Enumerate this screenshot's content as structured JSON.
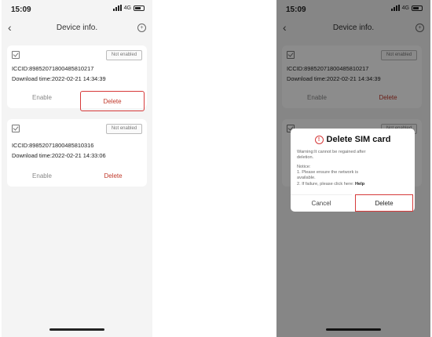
{
  "status": {
    "time": "15:09",
    "network": "4G"
  },
  "nav": {
    "title": "Device info."
  },
  "cards": [
    {
      "badge": "Not enabled",
      "iccid": "ICCID:89852071800485810217",
      "download": "Download time:2022-02-21 14:34:39",
      "enable_label": "Enable",
      "delete_label": "Delete"
    },
    {
      "badge": "Not enabled",
      "iccid": "ICCID:89852071800485810316",
      "download": "Download time:2022-02-21 14:33:06",
      "enable_label": "Enable",
      "delete_label": "Delete"
    }
  ],
  "dialog": {
    "title": "Delete SIM card",
    "warning_line1": "Warning:It cannot be regained after",
    "warning_line2": "deletion.",
    "notice_label": "Notice:",
    "notice_1a": "1. Please ensure the network is",
    "notice_1b": "available.",
    "notice_2": "2. If failure, please click here:",
    "help_label": "Help",
    "cancel_label": "Cancel",
    "delete_label": "Delete"
  },
  "colors": {
    "accent_red": "#d63a3a",
    "delete_text": "#c0392b"
  }
}
